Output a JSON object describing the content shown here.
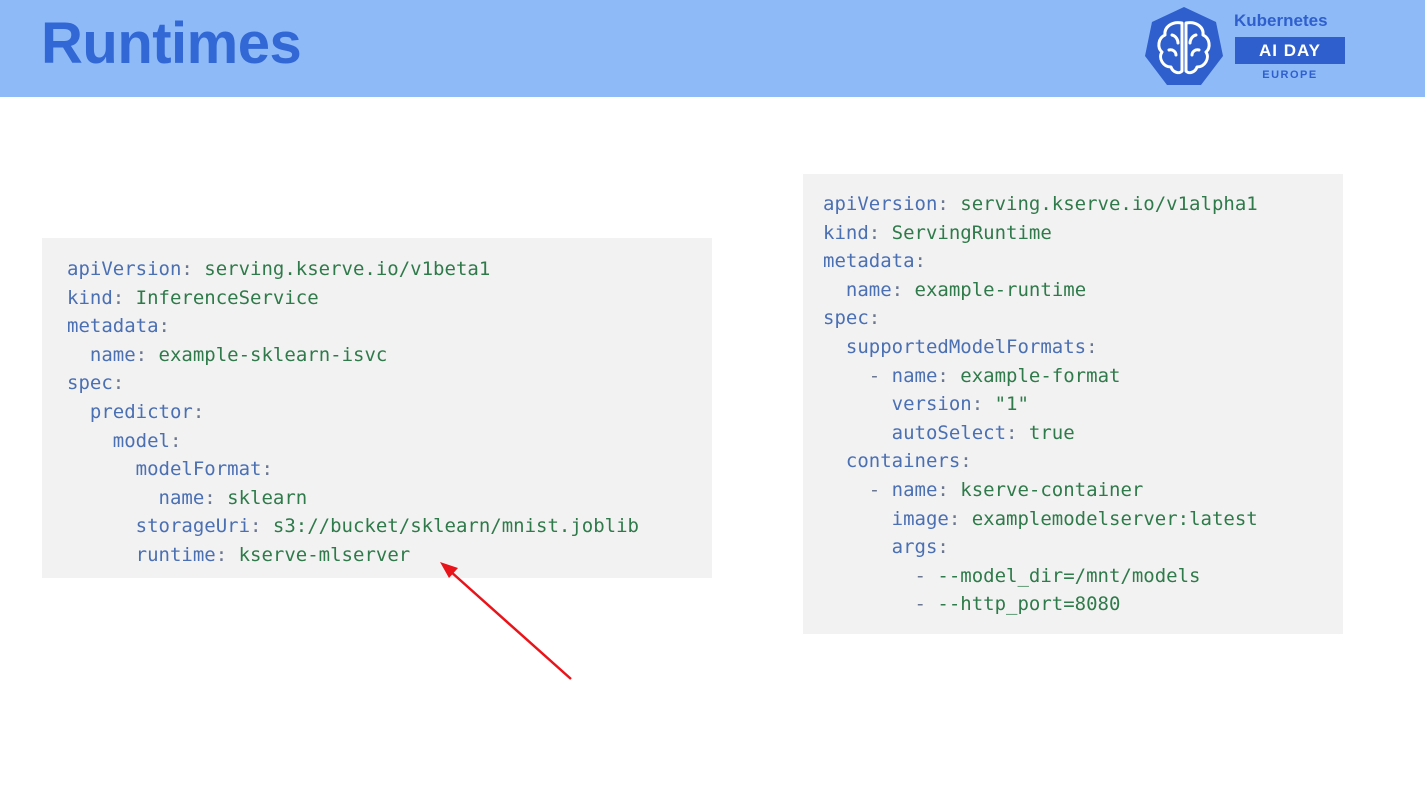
{
  "slide": {
    "title": "Runtimes"
  },
  "logo": {
    "brand": "Kubernetes",
    "event": "AI DAY",
    "region": "EUROPE"
  },
  "left_code": {
    "lines": [
      {
        "indent": "",
        "key": "apiVersion",
        "sep": ": ",
        "value": "serving.kserve.io/v1beta1"
      },
      {
        "indent": "",
        "key": "kind",
        "sep": ": ",
        "value": "InferenceService"
      },
      {
        "indent": "",
        "key": "metadata",
        "sep": ":",
        "value": ""
      },
      {
        "indent": "  ",
        "key": "name",
        "sep": ": ",
        "value": "example-sklearn-isvc"
      },
      {
        "indent": "",
        "key": "spec",
        "sep": ":",
        "value": ""
      },
      {
        "indent": "  ",
        "key": "predictor",
        "sep": ":",
        "value": ""
      },
      {
        "indent": "    ",
        "key": "model",
        "sep": ":",
        "value": ""
      },
      {
        "indent": "      ",
        "key": "modelFormat",
        "sep": ":",
        "value": ""
      },
      {
        "indent": "        ",
        "key": "name",
        "sep": ": ",
        "value": "sklearn"
      },
      {
        "indent": "      ",
        "key": "storageUri",
        "sep": ": ",
        "value": "s3://bucket/sklearn/mnist.joblib"
      },
      {
        "indent": "      ",
        "key": "runtime",
        "sep": ": ",
        "value": "kserve-mlserver"
      }
    ]
  },
  "right_code": {
    "lines": [
      {
        "indent": "",
        "key": "apiVersion",
        "sep": ": ",
        "value": "serving.kserve.io/v1alpha1"
      },
      {
        "indent": "",
        "key": "kind",
        "sep": ": ",
        "value": "ServingRuntime"
      },
      {
        "indent": "",
        "key": "metadata",
        "sep": ":",
        "value": ""
      },
      {
        "indent": "  ",
        "key": "name",
        "sep": ": ",
        "value": "example-runtime"
      },
      {
        "indent": "",
        "key": "spec",
        "sep": ":",
        "value": ""
      },
      {
        "indent": "  ",
        "key": "supportedModelFormats",
        "sep": ":",
        "value": ""
      },
      {
        "indent": "    - ",
        "key": "name",
        "sep": ": ",
        "value": "example-format"
      },
      {
        "indent": "      ",
        "key": "version",
        "sep": ": ",
        "value": "\"1\""
      },
      {
        "indent": "      ",
        "key": "autoSelect",
        "sep": ": ",
        "value": "true"
      },
      {
        "indent": "  ",
        "key": "containers",
        "sep": ":",
        "value": ""
      },
      {
        "indent": "    - ",
        "key": "name",
        "sep": ": ",
        "value": "kserve-container"
      },
      {
        "indent": "      ",
        "key": "image",
        "sep": ": ",
        "value": "examplemodelserver:latest"
      },
      {
        "indent": "      ",
        "key": "args",
        "sep": ":",
        "value": ""
      },
      {
        "indent": "        - ",
        "key": "",
        "sep": "",
        "value": "--model_dir=/mnt/models"
      },
      {
        "indent": "        - ",
        "key": "",
        "sep": "",
        "value": "--http_port=8080"
      }
    ]
  },
  "annotation": {
    "arrow_color": "#e8141a",
    "target": "runtime: kserve-mlserver"
  },
  "colors": {
    "header_bg": "#8fbaf8",
    "title": "#3268d5",
    "logo": "#2e5fcc",
    "code_bg": "#f2f2f2",
    "code_key": "#4a6fb3",
    "code_value": "#2f7a4a"
  }
}
